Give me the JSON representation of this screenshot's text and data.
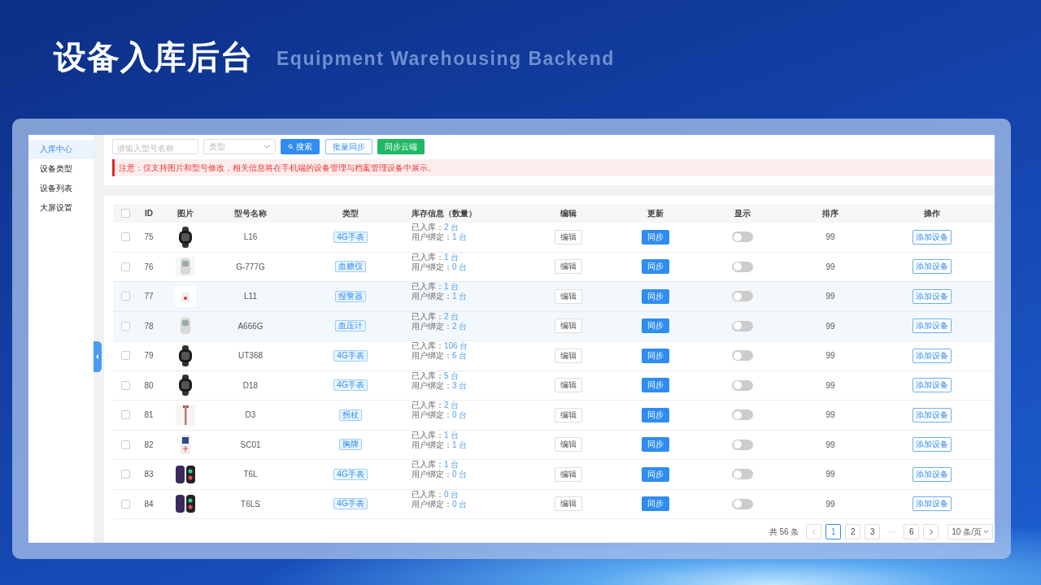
{
  "slide": {
    "title": "设备入库后台",
    "subtitle": "Equipment Warehousing Backend"
  },
  "sidebar": {
    "items": [
      {
        "label": "入库中心",
        "selected": true
      },
      {
        "label": "设备类型",
        "selected": false
      },
      {
        "label": "设备列表",
        "selected": false
      },
      {
        "label": "大屏设置",
        "selected": false
      }
    ]
  },
  "toolbar": {
    "search": {
      "placeholder": "请输入型号名称"
    },
    "type_select": {
      "placeholder": "类型"
    },
    "buttons": [
      {
        "label": "搜索",
        "kind": "search"
      },
      {
        "label": "批量同步",
        "kind": "outline"
      },
      {
        "label": "同步云端",
        "kind": "green"
      }
    ]
  },
  "notice": "注意：仅支持图片和型号修改，相关信息将在手机端的设备管理与档案管理设备中展示。",
  "table": {
    "select_all_checked": false,
    "columns": [
      "ID",
      "图片",
      "型号名称",
      "类型",
      "库存信息（数量）",
      "编辑",
      "更新",
      "显示",
      "排序",
      "操作"
    ],
    "rows": [
      {
        "checked": false,
        "highlighted": false,
        "id": "75",
        "kind": "picture",
        "name": "L16",
        "type": "4G手表",
        "stock": [
          {
            "label": "已入库：",
            "value": "2 台"
          },
          {
            "label": "用户绑定：",
            "value": "1 台"
          }
        ],
        "edit": "编辑",
        "update": "同步",
        "on": false,
        "sort": "99",
        "action": "添加设备"
      },
      {
        "checked": false,
        "highlighted": false,
        "id": "76",
        "kind": "picture",
        "name": "G-777G",
        "type": "血糖仪",
        "stock": [
          {
            "label": "已入库：",
            "value": "1 台"
          },
          {
            "label": "用户绑定：",
            "value": "0 台"
          }
        ],
        "edit": "编辑",
        "update": "同步",
        "on": false,
        "sort": "99",
        "action": "添加设备"
      },
      {
        "checked": false,
        "highlighted": true,
        "id": "77",
        "kind": "picture",
        "name": "L11",
        "type": "报警器",
        "stock": [
          {
            "label": "已入库：",
            "value": "1 台"
          },
          {
            "label": "用户绑定：",
            "value": "1 台"
          }
        ],
        "edit": "编辑",
        "update": "同步",
        "on": false,
        "sort": "99",
        "action": "添加设备"
      },
      {
        "checked": false,
        "highlighted": true,
        "id": "78",
        "kind": "picture",
        "name": "A666G",
        "type": "血压计",
        "stock": [
          {
            "label": "已入库：",
            "value": "2 台"
          },
          {
            "label": "用户绑定：",
            "value": "2 台"
          }
        ],
        "edit": "编辑",
        "update": "同步",
        "on": false,
        "sort": "99",
        "action": "添加设备"
      },
      {
        "checked": false,
        "highlighted": false,
        "id": "79",
        "kind": "picture",
        "name": "UT368",
        "type": "4G手表",
        "stock": [
          {
            "label": "已入库：",
            "value": "106 台"
          },
          {
            "label": "用户绑定：",
            "value": "6 台"
          }
        ],
        "edit": "编辑",
        "update": "同步",
        "on": false,
        "sort": "99",
        "action": "添加设备"
      },
      {
        "checked": false,
        "highlighted": false,
        "id": "80",
        "kind": "picture",
        "name": "D18",
        "type": "4G手表",
        "stock": [
          {
            "label": "已入库：",
            "value": "5 台"
          },
          {
            "label": "用户绑定：",
            "value": "3 台"
          }
        ],
        "edit": "编辑",
        "update": "同步",
        "on": false,
        "sort": "99",
        "action": "添加设备"
      },
      {
        "checked": false,
        "highlighted": false,
        "id": "81",
        "kind": "picture",
        "name": "D3",
        "type": "拐杖",
        "stock": [
          {
            "label": "已入库：",
            "value": "2 台"
          },
          {
            "label": "用户绑定：",
            "value": "0 台"
          }
        ],
        "edit": "编辑",
        "update": "同步",
        "on": false,
        "sort": "99",
        "action": "添加设备"
      },
      {
        "checked": false,
        "highlighted": false,
        "id": "82",
        "kind": "picture",
        "name": "SC01",
        "type": "胸牌",
        "stock": [
          {
            "label": "已入库：",
            "value": "1 台"
          },
          {
            "label": "用户绑定：",
            "value": "1 台"
          }
        ],
        "edit": "编辑",
        "update": "同步",
        "on": false,
        "sort": "99",
        "action": "添加设备"
      },
      {
        "checked": false,
        "highlighted": false,
        "id": "83",
        "kind": "picture",
        "name": "T6L",
        "type": "4G手表",
        "stock": [
          {
            "label": "已入库：",
            "value": "1 台"
          },
          {
            "label": "用户绑定：",
            "value": "0 台"
          }
        ],
        "edit": "编辑",
        "update": "同步",
        "on": false,
        "sort": "99",
        "action": "添加设备"
      },
      {
        "checked": false,
        "highlighted": false,
        "id": "84",
        "kind": "picture",
        "name": "T6LS",
        "type": "4G手表",
        "stock": [
          {
            "label": "已入库：",
            "value": "0 台"
          },
          {
            "label": "用户绑定：",
            "value": "0 台"
          }
        ],
        "edit": "编辑",
        "update": "同步",
        "on": false,
        "sort": "99",
        "action": "添加设备"
      }
    ]
  },
  "pagination": {
    "total": "共 56 条",
    "pages": [
      {
        "label": "1",
        "selected": true
      },
      {
        "label": "2",
        "selected": false
      },
      {
        "label": "3",
        "selected": false
      },
      {
        "label": "···",
        "kind": "ellipsis"
      },
      {
        "label": "6",
        "selected": false
      }
    ],
    "page_size": "10 条/页"
  }
}
